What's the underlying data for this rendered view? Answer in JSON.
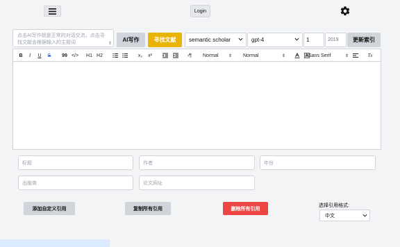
{
  "header": {
    "login_label": "Login",
    "menu_icon": "hamburger-icon",
    "settings_icon": "gear-icon"
  },
  "composer": {
    "prompt_placeholder": "点击AI写作就是正常的对话交流，点击寻找文献会根据输入的主题词",
    "ai_write_label": "AI写作",
    "find_refs_label": "寻找文献",
    "source_value": "semantic scholar",
    "model_value": "gpt-4",
    "count_value": "1",
    "year_value": "2019",
    "refresh_label": "更新索引",
    "accent_color": "#eab308"
  },
  "toolbar": {
    "bold": "B",
    "italic": "I",
    "underline": "U",
    "strike": "S",
    "quote": "99",
    "code": "</>",
    "h1": "H1",
    "h2": "H2",
    "sub": "x₂",
    "sup": "x²",
    "direction": "›¶",
    "size": "Normal",
    "header": "Normal",
    "font": "Sans Serif",
    "clean": "Tx"
  },
  "reference_form": {
    "title_placeholder": "标题",
    "author_placeholder": "作者",
    "year_placeholder": "年份",
    "publisher_placeholder": "出版商",
    "url_placeholder": "论文网址"
  },
  "actions": {
    "add_custom_label": "添加自定义引用",
    "copy_all_label": "复制所有引用",
    "delete_all_label": "删除所有引用",
    "delete_color": "#ef4444"
  },
  "citation_format": {
    "label": "选择引用格式:",
    "selected": "中文"
  }
}
